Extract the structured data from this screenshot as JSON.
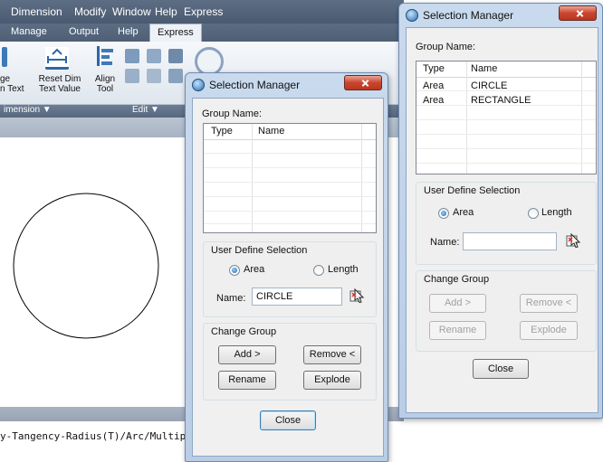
{
  "cad": {
    "menu": [
      "Dimension",
      "Modify",
      "Window",
      "Help",
      "Express"
    ],
    "ribbon_tabs": [
      "Manage",
      "Output",
      "Help",
      "Express"
    ],
    "active_tab": "Express",
    "ribbon_labels": [
      "ge\nn Text",
      "Reset Dim\nText Value",
      "Align\nTool"
    ],
    "group_labels": [
      "imension ▼",
      "Edit ▼"
    ],
    "command_line": "y-Tangency-Radius(T)/Arc/Multiple]",
    "circle_color": "#000000"
  },
  "dialog_front": {
    "title": "Selection Manager",
    "group_name_label": "Group Name:",
    "columns": [
      "Type",
      "Name"
    ],
    "rows": [],
    "user_define_label": "User Define Selection",
    "radio_area": "Area",
    "radio_length": "Length",
    "selected_radio": "Area",
    "name_label": "Name:",
    "name_value": "CIRCLE",
    "change_group_label": "Change Group",
    "add_label": "Add >",
    "remove_label": "Remove <",
    "rename_label": "Rename",
    "explode_label": "Explode",
    "close_label": "Close"
  },
  "dialog_back": {
    "title": "Selection Manager",
    "group_name_label": "Group Name:",
    "columns": [
      "Type",
      "Name"
    ],
    "rows": [
      {
        "type": "Area",
        "name": "CIRCLE"
      },
      {
        "type": "Area",
        "name": "RECTANGLE"
      }
    ],
    "user_define_label": "User Define Selection",
    "radio_area": "Area",
    "radio_length": "Length",
    "selected_radio": "Area",
    "name_label": "Name:",
    "name_value": "",
    "change_group_label": "Change Group",
    "add_label": "Add >",
    "remove_label": "Remove <",
    "rename_label": "Rename",
    "explode_label": "Explode",
    "close_label": "Close"
  }
}
